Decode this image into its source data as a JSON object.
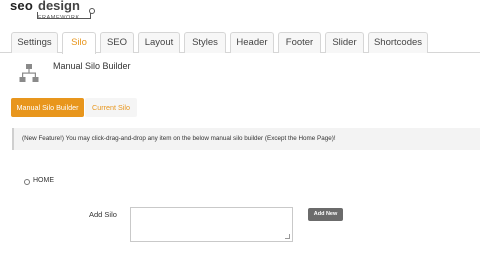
{
  "logo": {
    "seo": "seo",
    "design": "design",
    "framework": "FRAMEWORK"
  },
  "tabs": [
    {
      "label": "Settings"
    },
    {
      "label": "Silo"
    },
    {
      "label": "SEO"
    },
    {
      "label": "Layout"
    },
    {
      "label": "Styles"
    },
    {
      "label": "Header"
    },
    {
      "label": "Footer"
    },
    {
      "label": "Slider"
    },
    {
      "label": "Shortcodes"
    }
  ],
  "active_tab": "Silo",
  "section": {
    "icon": "sitemap-icon",
    "title": "Manual Silo Builder"
  },
  "subnav": {
    "manual": "Manual Silo Builder",
    "current": "Current Silo"
  },
  "notice": "(New Feature!) You may click-drag-and-drop any item on the below manual silo builder (Except the Home Page)!",
  "silo_items": [
    {
      "label": "HOME"
    }
  ],
  "add_silo": {
    "label": "Add Silo",
    "value": "",
    "button": "Add New"
  },
  "colors": {
    "accent": "#e8961d",
    "button_dark": "#6b6b6b",
    "notice_bg": "#f3f3f3"
  }
}
